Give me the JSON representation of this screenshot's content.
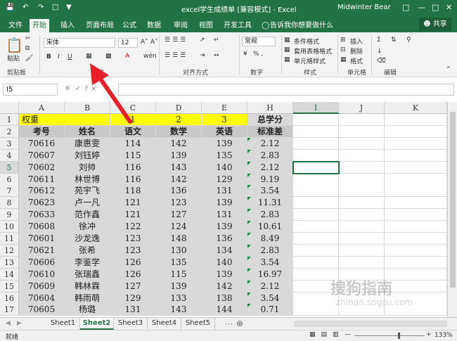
{
  "title": {
    "document": "excel学生成绩单 [兼容模式] - Excel",
    "user": "Midwinter Bear"
  },
  "tabs": [
    "文件",
    "开始",
    "插入",
    "页面布局",
    "公式",
    "数据",
    "审阅",
    "视图",
    "开发工具"
  ],
  "tell_me": "告诉我你想要做什么",
  "share": "共享",
  "ribbon": {
    "paste": "粘贴",
    "clipboard": "剪贴板",
    "font_name": "宋体",
    "font_size": "12",
    "bold": "B",
    "italic": "I",
    "underline": "U",
    "font_group": "字体",
    "align_group": "对齐方式",
    "number_format": "常规",
    "number_group": "数字",
    "percent": "% ,",
    "cond_format": "条件格式",
    "table_format": "套用表格格式",
    "cell_style": "单元格样式",
    "style_group": "样式",
    "insert": "插入",
    "delete": "删除",
    "format": "格式",
    "cells_group": "单元格",
    "edit_group": "编辑"
  },
  "namebox": "I5",
  "columns": [
    "A",
    "B",
    "C",
    "D",
    "E",
    "H",
    "I",
    "J",
    "K"
  ],
  "rows": [
    [
      "权重",
      "",
      "1",
      "2",
      "3",
      "总学分"
    ],
    [
      "考号",
      "姓名",
      "语文",
      "数学",
      "英语",
      "标准差"
    ],
    [
      "70616",
      "康惠雯",
      "114",
      "142",
      "139",
      "2.12"
    ],
    [
      "70607",
      "刘钰婷",
      "115",
      "139",
      "135",
      "2.83"
    ],
    [
      "70602",
      "刘帅",
      "116",
      "143",
      "140",
      "2.12"
    ],
    [
      "70611",
      "林世博",
      "116",
      "142",
      "129",
      "9.19"
    ],
    [
      "70612",
      "苑宇飞",
      "118",
      "136",
      "131",
      "3.54"
    ],
    [
      "70623",
      "卢一凡",
      "121",
      "123",
      "139",
      "11.31"
    ],
    [
      "70633",
      "范作鑫",
      "121",
      "127",
      "131",
      "2.83"
    ],
    [
      "70608",
      "徐冲",
      "122",
      "124",
      "139",
      "10.61"
    ],
    [
      "70601",
      "沙龙逸",
      "123",
      "148",
      "136",
      "8.49"
    ],
    [
      "70621",
      "张希",
      "123",
      "130",
      "134",
      "2.83"
    ],
    [
      "70606",
      "李鉴学",
      "126",
      "135",
      "140",
      "3.54"
    ],
    [
      "70610",
      "张瑞鑫",
      "126",
      "115",
      "139",
      "16.97"
    ],
    [
      "70609",
      "韩林霖",
      "127",
      "139",
      "142",
      "2.12"
    ],
    [
      "70604",
      "韩雨萌",
      "129",
      "133",
      "138",
      "3.54"
    ],
    [
      "70605",
      "杨璐",
      "131",
      "143",
      "144",
      "0.71"
    ]
  ],
  "sheets": [
    "Sheet1",
    "Sheet2",
    "Sheet3",
    "Sheet4",
    "Sheet5"
  ],
  "status": {
    "ready": "就绪",
    "zoom": "133%"
  },
  "watermark": {
    "text": "搜狗指南",
    "url": "zhinan.sogou.com"
  },
  "colors": {
    "excel_green": "#217346",
    "weight_row": "#ffff00",
    "header_row": "#c8c8c8",
    "data_fill": "#d9d9d9",
    "arrow": "#e8202a"
  }
}
